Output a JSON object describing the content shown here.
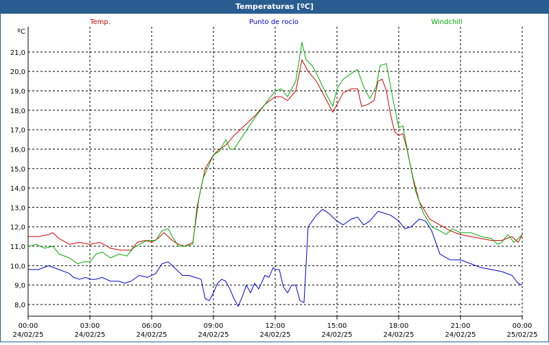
{
  "window": {
    "title": "Temperaturas [ºC]"
  },
  "chart_data": {
    "type": "line",
    "title": "Temperaturas [ºC]",
    "ylabel": "ºC",
    "ylim": [
      7.4,
      22.3
    ],
    "yticks": [
      8.0,
      9.0,
      10.0,
      11.0,
      12.0,
      13.0,
      14.0,
      15.0,
      16.0,
      17.0,
      18.0,
      19.0,
      20.0,
      21.0
    ],
    "ytick_labels": [
      "8,0",
      "9,0",
      "10,0",
      "11,0",
      "12,0",
      "13,0",
      "14,0",
      "15,0",
      "16,0",
      "17,0",
      "18,0",
      "19,0",
      "20,0",
      "21,0"
    ],
    "xlim": [
      0,
      24
    ],
    "xticks": [
      {
        "x": 0,
        "time": "00:00",
        "date": "24/02/25"
      },
      {
        "x": 3,
        "time": "03:00",
        "date": "24/02/25"
      },
      {
        "x": 6,
        "time": "06:00",
        "date": "24/02/25"
      },
      {
        "x": 9,
        "time": "09:00",
        "date": "24/02/25"
      },
      {
        "x": 12,
        "time": "12:00",
        "date": "24/02/25"
      },
      {
        "x": 15,
        "time": "15:00",
        "date": "24/02/25"
      },
      {
        "x": 18,
        "time": "18:00",
        "date": "24/02/25"
      },
      {
        "x": 21,
        "time": "21:00",
        "date": "24/02/25"
      },
      {
        "x": 24,
        "time": "00:00",
        "date": "25/02/25"
      }
    ],
    "grid": true,
    "series": [
      {
        "name": "Temp.",
        "color": "#cc0000",
        "legend_align": "left",
        "points": [
          [
            0,
            11.5
          ],
          [
            0.5,
            11.5
          ],
          [
            1,
            11.6
          ],
          [
            1.2,
            11.7
          ],
          [
            1.5,
            11.4
          ],
          [
            2,
            11.1
          ],
          [
            2.5,
            11.2
          ],
          [
            3,
            11.1
          ],
          [
            3.5,
            11.2
          ],
          [
            4,
            10.9
          ],
          [
            4.5,
            10.8
          ],
          [
            5,
            10.8
          ],
          [
            5.3,
            11.2
          ],
          [
            5.7,
            11.3
          ],
          [
            6,
            11.2
          ],
          [
            6.3,
            11.4
          ],
          [
            6.6,
            11.7
          ],
          [
            7,
            11.3
          ],
          [
            7.3,
            11.1
          ],
          [
            7.6,
            11.0
          ],
          [
            8,
            11.2
          ],
          [
            8.3,
            13.5
          ],
          [
            8.6,
            15.0
          ],
          [
            9,
            15.7
          ],
          [
            9.3,
            16.0
          ],
          [
            9.6,
            16.2
          ],
          [
            10,
            16.7
          ],
          [
            10.5,
            17.2
          ],
          [
            11,
            17.7
          ],
          [
            11.5,
            18.3
          ],
          [
            12,
            18.7
          ],
          [
            12.3,
            18.7
          ],
          [
            12.6,
            18.5
          ],
          [
            13,
            19.0
          ],
          [
            13.3,
            20.6
          ],
          [
            13.6,
            20.0
          ],
          [
            14,
            19.5
          ],
          [
            14.5,
            18.5
          ],
          [
            14.8,
            17.9
          ],
          [
            15,
            18.3
          ],
          [
            15.3,
            18.9
          ],
          [
            15.7,
            19.1
          ],
          [
            16,
            19.1
          ],
          [
            16.2,
            18.2
          ],
          [
            16.5,
            18.3
          ],
          [
            16.8,
            18.5
          ],
          [
            17,
            19.5
          ],
          [
            17.2,
            19.6
          ],
          [
            17.4,
            19.0
          ],
          [
            17.6,
            17.8
          ],
          [
            17.8,
            16.9
          ],
          [
            18,
            16.7
          ],
          [
            18.2,
            16.8
          ],
          [
            18.4,
            16.0
          ],
          [
            18.7,
            14.5
          ],
          [
            19,
            13.3
          ],
          [
            19.5,
            12.4
          ],
          [
            20,
            12.1
          ],
          [
            20.5,
            11.8
          ],
          [
            21,
            11.6
          ],
          [
            21.5,
            11.5
          ],
          [
            22,
            11.4
          ],
          [
            22.5,
            11.3
          ],
          [
            23,
            11.3
          ],
          [
            23.5,
            11.5
          ],
          [
            23.8,
            11.2
          ],
          [
            24,
            11.6
          ]
        ]
      },
      {
        "name": "Punto de rocío",
        "color": "#0000cc",
        "legend_align": "center",
        "points": [
          [
            0,
            9.8
          ],
          [
            0.5,
            9.8
          ],
          [
            1,
            10.0
          ],
          [
            1.5,
            9.8
          ],
          [
            2,
            9.6
          ],
          [
            2.2,
            9.4
          ],
          [
            2.5,
            9.3
          ],
          [
            2.8,
            9.4
          ],
          [
            3,
            9.3
          ],
          [
            3.3,
            9.3
          ],
          [
            3.6,
            9.4
          ],
          [
            4,
            9.2
          ],
          [
            4.4,
            9.2
          ],
          [
            4.7,
            9.1
          ],
          [
            5,
            9.2
          ],
          [
            5.4,
            9.5
          ],
          [
            5.8,
            9.4
          ],
          [
            6.2,
            9.6
          ],
          [
            6.5,
            10.1
          ],
          [
            6.8,
            10.2
          ],
          [
            7,
            10.0
          ],
          [
            7.2,
            9.8
          ],
          [
            7.5,
            9.5
          ],
          [
            7.8,
            9.5
          ],
          [
            8.1,
            9.4
          ],
          [
            8.4,
            9.3
          ],
          [
            8.6,
            8.3
          ],
          [
            8.8,
            8.2
          ],
          [
            9,
            8.6
          ],
          [
            9.2,
            9.1
          ],
          [
            9.4,
            9.3
          ],
          [
            9.6,
            9.2
          ],
          [
            9.8,
            8.8
          ],
          [
            10,
            8.3
          ],
          [
            10.2,
            7.9
          ],
          [
            10.4,
            8.4
          ],
          [
            10.6,
            9.0
          ],
          [
            10.8,
            8.6
          ],
          [
            11,
            9.1
          ],
          [
            11.2,
            8.8
          ],
          [
            11.5,
            9.5
          ],
          [
            11.7,
            9.4
          ],
          [
            11.9,
            9.9
          ],
          [
            12,
            9.8
          ],
          [
            12.2,
            9.8
          ],
          [
            12.4,
            8.9
          ],
          [
            12.6,
            8.6
          ],
          [
            12.8,
            9.0
          ],
          [
            13.0,
            9.0
          ],
          [
            13.2,
            8.2
          ],
          [
            13.4,
            8.1
          ],
          [
            13.6,
            12.0
          ],
          [
            14,
            12.6
          ],
          [
            14.3,
            12.9
          ],
          [
            14.6,
            12.7
          ],
          [
            15,
            12.3
          ],
          [
            15.3,
            12.1
          ],
          [
            15.7,
            12.4
          ],
          [
            16,
            12.5
          ],
          [
            16.3,
            12.1
          ],
          [
            16.6,
            12.3
          ],
          [
            17,
            12.8
          ],
          [
            17.3,
            12.7
          ],
          [
            17.6,
            12.6
          ],
          [
            18,
            12.3
          ],
          [
            18.3,
            11.9
          ],
          [
            18.6,
            12.0
          ],
          [
            19,
            12.4
          ],
          [
            19.3,
            12.3
          ],
          [
            19.6,
            11.8
          ],
          [
            20,
            10.6
          ],
          [
            20.5,
            10.3
          ],
          [
            21,
            10.3
          ],
          [
            21.5,
            10.1
          ],
          [
            22,
            9.9
          ],
          [
            22.5,
            9.8
          ],
          [
            23,
            9.7
          ],
          [
            23.5,
            9.5
          ],
          [
            23.8,
            9.1
          ],
          [
            24,
            9.0
          ]
        ]
      },
      {
        "name": "Windchill",
        "color": "#00aa00",
        "legend_align": "right",
        "points": [
          [
            0,
            11.0
          ],
          [
            0.4,
            11.1
          ],
          [
            0.8,
            10.9
          ],
          [
            1.2,
            11.0
          ],
          [
            1.5,
            10.6
          ],
          [
            2,
            10.4
          ],
          [
            2.4,
            10.1
          ],
          [
            2.7,
            10.2
          ],
          [
            3,
            10.2
          ],
          [
            3.3,
            10.6
          ],
          [
            3.6,
            10.7
          ],
          [
            4,
            10.4
          ],
          [
            4.4,
            10.6
          ],
          [
            4.8,
            10.5
          ],
          [
            5.1,
            10.9
          ],
          [
            5.4,
            11.1
          ],
          [
            5.8,
            11.3
          ],
          [
            6.2,
            11.3
          ],
          [
            6.5,
            11.8
          ],
          [
            6.8,
            11.9
          ],
          [
            7,
            11.5
          ],
          [
            7.3,
            11.0
          ],
          [
            7.6,
            11.0
          ],
          [
            8,
            11.1
          ],
          [
            8.2,
            13.0
          ],
          [
            8.5,
            14.5
          ],
          [
            9,
            15.7
          ],
          [
            9.3,
            15.9
          ],
          [
            9.6,
            16.5
          ],
          [
            9.8,
            16.0
          ],
          [
            10,
            16.0
          ],
          [
            10.5,
            16.8
          ],
          [
            11,
            17.6
          ],
          [
            11.5,
            18.3
          ],
          [
            12,
            19.0
          ],
          [
            12.3,
            19.1
          ],
          [
            12.6,
            18.7
          ],
          [
            13,
            19.5
          ],
          [
            13.3,
            21.5
          ],
          [
            13.5,
            20.6
          ],
          [
            13.8,
            20.3
          ],
          [
            14,
            19.9
          ],
          [
            14.5,
            18.8
          ],
          [
            14.8,
            18.2
          ],
          [
            15,
            19.1
          ],
          [
            15.3,
            19.6
          ],
          [
            15.7,
            19.9
          ],
          [
            16,
            20.1
          ],
          [
            16.3,
            19.2
          ],
          [
            16.6,
            18.6
          ],
          [
            16.9,
            19.2
          ],
          [
            17.1,
            20.3
          ],
          [
            17.4,
            20.4
          ],
          [
            17.7,
            18.7
          ],
          [
            18,
            17.1
          ],
          [
            18.2,
            17.2
          ],
          [
            18.5,
            15.5
          ],
          [
            18.8,
            13.9
          ],
          [
            19.2,
            12.7
          ],
          [
            19.6,
            12.0
          ],
          [
            20,
            11.8
          ],
          [
            20.3,
            11.6
          ],
          [
            20.6,
            11.9
          ],
          [
            21,
            11.7
          ],
          [
            21.5,
            11.7
          ],
          [
            22,
            11.5
          ],
          [
            22.5,
            11.4
          ],
          [
            22.8,
            11.1
          ],
          [
            23,
            11.2
          ],
          [
            23.3,
            11.6
          ],
          [
            23.6,
            11.2
          ],
          [
            24,
            11.6
          ]
        ]
      }
    ]
  }
}
